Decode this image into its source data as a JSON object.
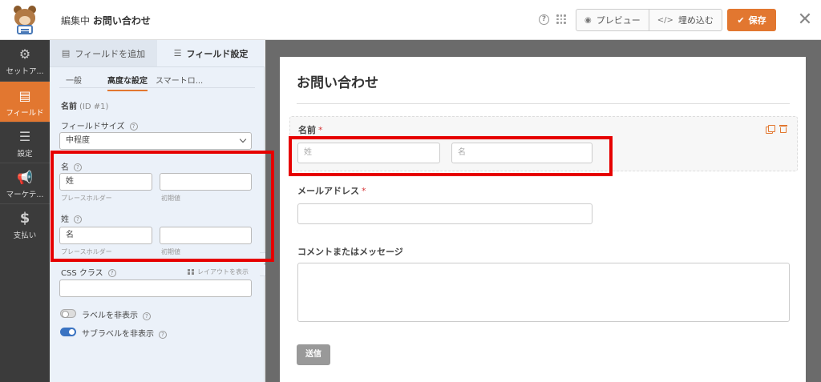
{
  "header": {
    "editing_prefix": "編集中",
    "form_name": "お問い合わせ",
    "help_icon": "question-circle-icon",
    "menu_icon": "grid-dots-icon",
    "preview_label": "プレビュー",
    "embed_label": "埋め込む",
    "save_label": "保存",
    "close_glyph": "✕"
  },
  "colors": {
    "accent": "#e27730",
    "highlight": "#e60000",
    "nav_bg": "#3b3b3b",
    "panel_bg": "#ebf1f9",
    "toggle_on": "#3a73c2"
  },
  "leftnav": {
    "items": [
      {
        "icon": "gear-icon",
        "label": "セットア..."
      },
      {
        "icon": "fields-list-icon",
        "label": "フィールド",
        "active": true
      },
      {
        "icon": "sliders-icon",
        "label": "設定"
      },
      {
        "icon": "megaphone-icon",
        "label": "マーケテ..."
      },
      {
        "icon": "dollar-icon",
        "label": "支払い"
      }
    ]
  },
  "panel": {
    "tabs": {
      "add_fields": "フィールドを追加",
      "field_options": "フィールド設定"
    },
    "subtabs": {
      "general": "一般",
      "advanced": "高度な設定",
      "smart": "スマートロ..."
    },
    "field_heading": "名前",
    "field_id": "(ID #1)",
    "size_label": "フィールドサイズ",
    "size_value": "中程度",
    "first": {
      "label": "名",
      "placeholder_value": "姓",
      "default_value": "",
      "placeholder_hint": "プレースホルダー",
      "default_hint": "初期値"
    },
    "last": {
      "label": "姓",
      "placeholder_value": "名",
      "default_value": "",
      "placeholder_hint": "プレースホルダー",
      "default_hint": "初期値"
    },
    "css_label": "CSS クラス",
    "layout_link": "レイアウトを表示",
    "css_value": "",
    "hide_label_toggle": "ラベルを非表示",
    "hide_sublabel_toggle": "サブラベルを非表示"
  },
  "preview": {
    "form_title": "お問い合わせ",
    "name_label": "名前",
    "first_placeholder": "姓",
    "last_placeholder": "名",
    "email_label": "メールアドレス",
    "message_label": "コメントまたはメッセージ",
    "required_mark": "*",
    "submit_label": "送信"
  }
}
